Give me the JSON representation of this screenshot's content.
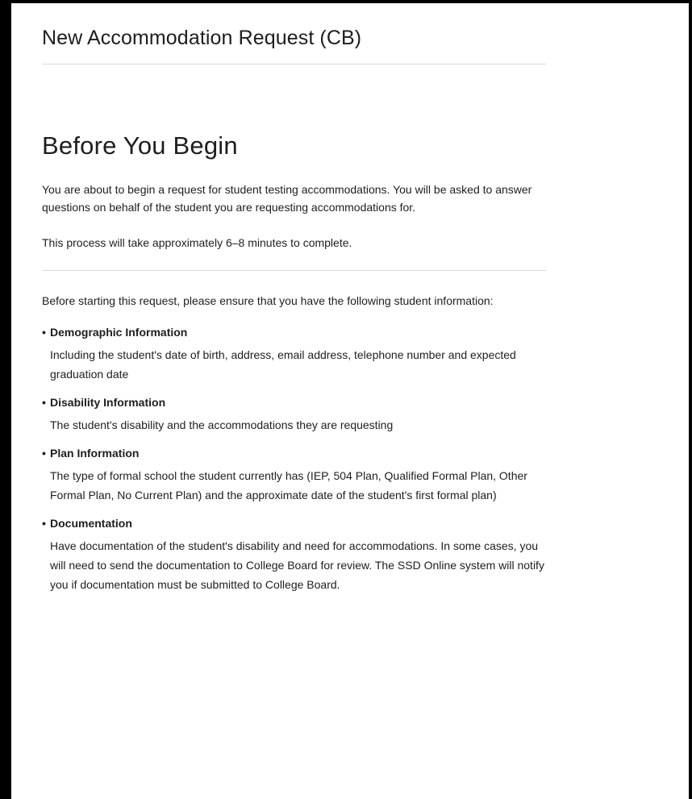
{
  "header": {
    "title": "New Accommodation Request (CB)"
  },
  "main": {
    "heading": "Before You Begin",
    "intro": "You are about to begin a request for student testing accommodations. You will be asked to answer questions on behalf of the student you are requesting accommodations for.",
    "duration": "This process will take approximately 6–8 minutes to complete.",
    "prerequisites_intro": "Before starting this request, please ensure that you have the following student information:",
    "requirements": [
      {
        "title": "Demographic Information",
        "description": "Including the student's date of birth, address, email address, telephone number and expected graduation date"
      },
      {
        "title": "Disability Information",
        "description": "The student's disability and the accommodations they are requesting"
      },
      {
        "title": "Plan Information",
        "description": "The type of formal school the student currently has (IEP, 504 Plan, Qualified Formal Plan, Other Formal Plan, No Current Plan) and the approximate date of the student's first formal plan)"
      },
      {
        "title": "Documentation",
        "description": "Have documentation of the student's disability and need for accommodations. In some cases, you will need to send the documentation to College Board for review. The SSD Online system will notify you if documentation must be submitted to College Board."
      }
    ]
  }
}
